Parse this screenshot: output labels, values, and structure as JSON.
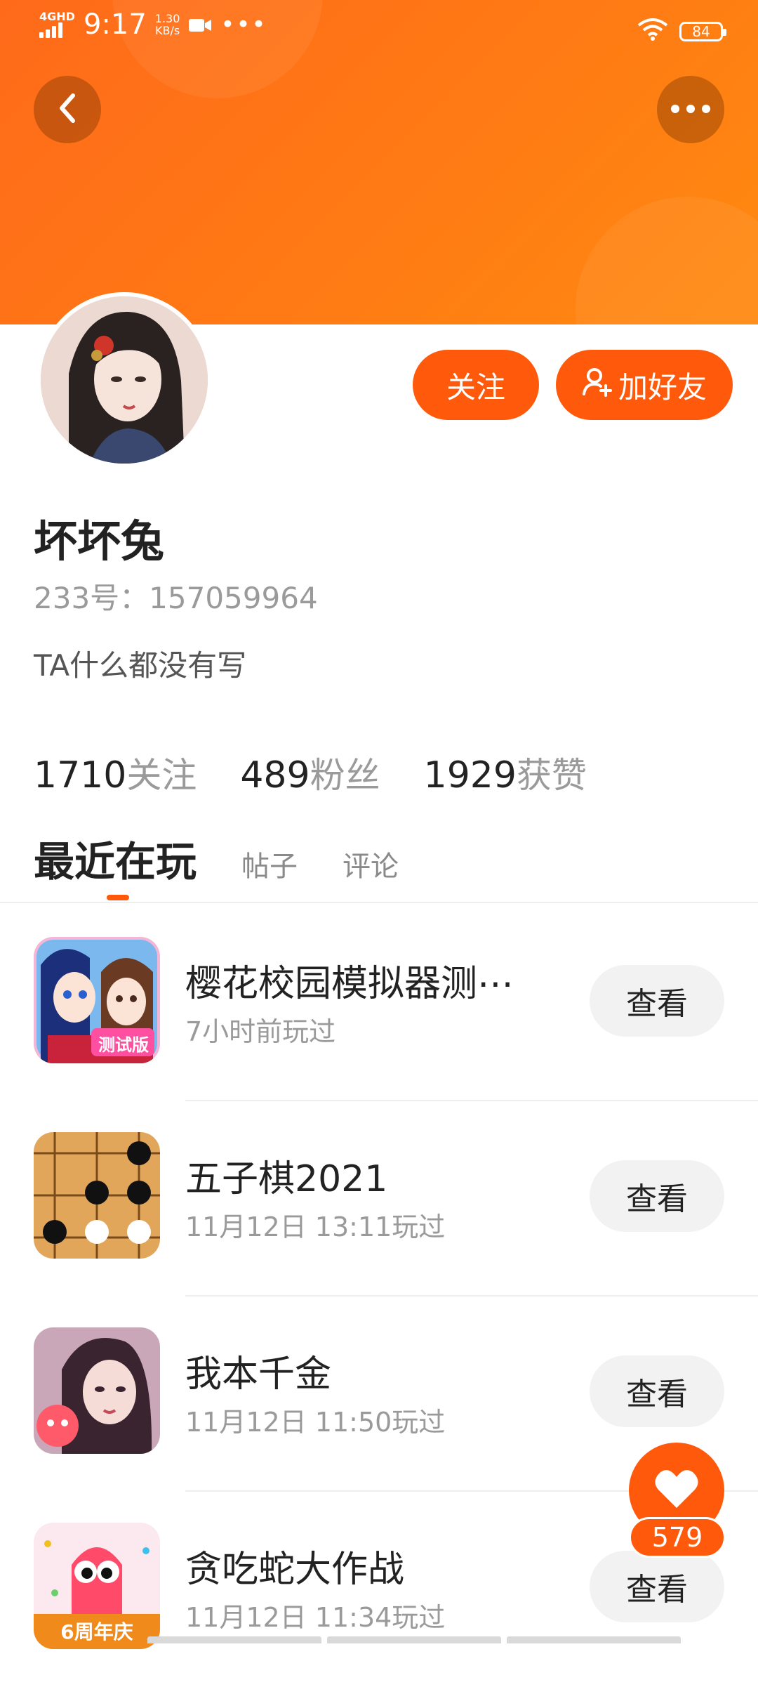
{
  "status_bar": {
    "network": "4GHD",
    "time": "9:17",
    "speed_value": "1.30",
    "speed_unit": "KB/s",
    "battery": "84"
  },
  "header": {
    "back_icon": "back-arrow-icon",
    "more_icon": "more-dots-icon",
    "hero_color": "#ff7a14"
  },
  "profile": {
    "follow_label": "关注",
    "add_friend_label": "加好友",
    "name": "坏坏兔",
    "id_text": "233号：157059964",
    "bio": "TA什么都没有写",
    "stats": [
      {
        "value": "1710",
        "label": "关注"
      },
      {
        "value": "489",
        "label": "粉丝"
      },
      {
        "value": "1929",
        "label": "获赞"
      }
    ]
  },
  "tabs": {
    "active": "最近在玩",
    "posts": "帖子",
    "comments": "评论"
  },
  "games": [
    {
      "name": "樱花校园模拟器测⋯",
      "time": "7小时前玩过",
      "button": "查看",
      "icon_badge": "测试版"
    },
    {
      "name": "五子棋2021",
      "time": "11月12日 13:11玩过",
      "button": "查看"
    },
    {
      "name": "我本千金",
      "time": "11月12日 11:50玩过",
      "button": "查看"
    },
    {
      "name": "贪吃蛇大作战",
      "time": "11月12日 11:34玩过",
      "button": "查看",
      "icon_badge": "6周年庆"
    }
  ],
  "like_fab": {
    "count": "579",
    "icon": "heart-icon"
  },
  "accent_color": "#ff5a0c"
}
